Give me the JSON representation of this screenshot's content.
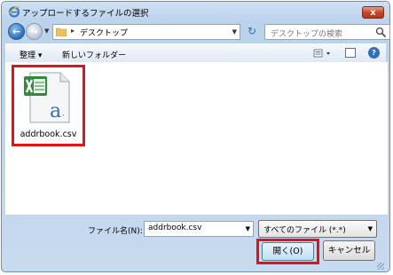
{
  "window": {
    "title": "アップロードするファイルの選択",
    "close_label": "x"
  },
  "nav": {
    "address": "デスクトップ",
    "search_placeholder": "デスクトップの検索"
  },
  "toolbar": {
    "organize": "整理 ▾",
    "new_folder": "新しいフォルダー"
  },
  "files": [
    {
      "name": "addrbook.csv",
      "icon": "excel-csv-file-icon"
    }
  ],
  "footer": {
    "filename_label": "ファイル名(N):",
    "filename_value": "addrbook.csv",
    "filter": "すべてのファイル (*.*)",
    "open_button": "開く(O)",
    "cancel_button": "キャンセル"
  },
  "colors": {
    "highlight": "#e3121a",
    "frame": "#bcd3ec",
    "accent": "#2d6fb8"
  }
}
